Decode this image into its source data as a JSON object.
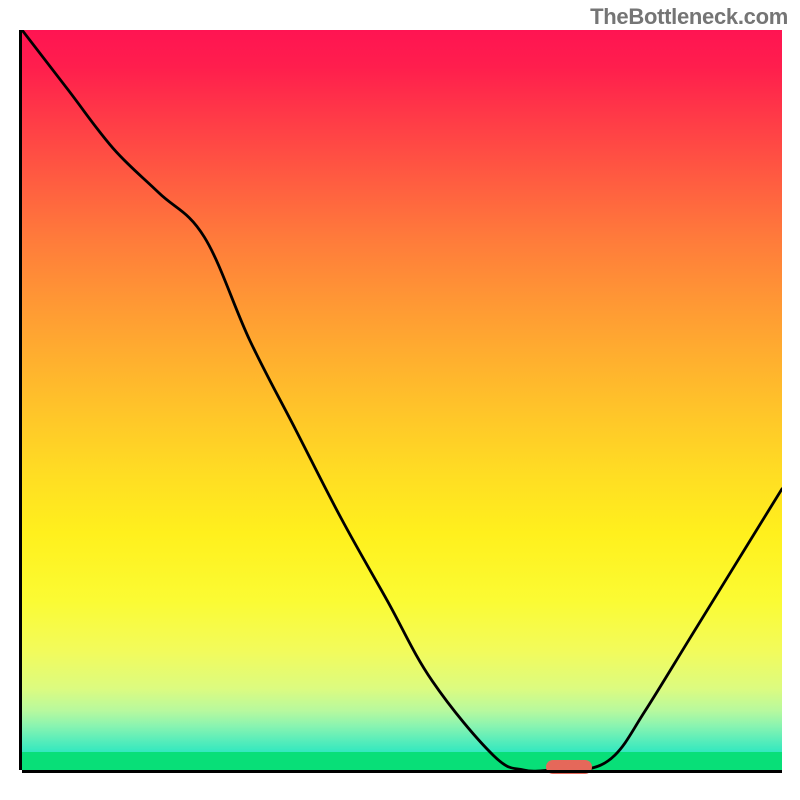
{
  "watermark": "TheBottleneck.com",
  "chart_data": {
    "type": "line",
    "title": "",
    "xlabel": "",
    "ylabel": "",
    "x": [
      0,
      6,
      12,
      18,
      24,
      30,
      36,
      42,
      48,
      54,
      62,
      66,
      70,
      74,
      78,
      82,
      88,
      94,
      100
    ],
    "values": [
      100,
      92,
      84,
      78,
      72,
      58,
      46,
      34,
      23,
      12,
      2,
      0,
      0,
      0,
      2,
      8,
      18,
      28,
      38
    ],
    "xlim": [
      0,
      100
    ],
    "ylim": [
      0,
      100
    ],
    "marker": {
      "x": 72,
      "y": 0
    },
    "colors": {
      "gradient_top": "#ff1452",
      "gradient_bottom": "#18e5c2",
      "marker": "#e5685a",
      "baseline_band": "#08df78"
    }
  }
}
